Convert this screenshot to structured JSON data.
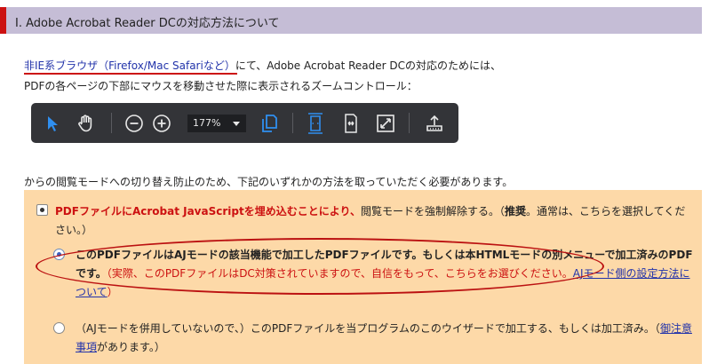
{
  "header": {
    "title": "I. Adobe Acrobat Reader DCの対応方法について"
  },
  "intro": {
    "link_text": "非IE系ブラウザ（Firefox/Mac Safariなど）",
    "line1_rest": "にて、Adobe Acrobat Reader DCの対応のためには、",
    "line2": "PDFの各ページの下部にマウスを移動させた際に表示されるズームコントロール："
  },
  "toolbar": {
    "zoom_value": "177%",
    "icons": [
      "select-arrow-icon",
      "hand-tool-icon",
      "zoom-out-icon",
      "zoom-in-icon",
      "zoom-dropdown",
      "copy-pages-icon",
      "fit-page-icon",
      "fit-width-icon",
      "fullscreen-icon",
      "download-icon"
    ],
    "accent_color": "#2f8ff0"
  },
  "line3": "からの閲覧モードへの切り替え防止のため、下記のいずれかの方法を取っていただく必要があります。",
  "options": {
    "opt1": {
      "red_part": "PDFファイルにAcrobat JavaScriptを埋め込むことにより、",
      "normal_part": "閲覧モードを強制解除する。（",
      "bold_part": "推奨",
      "tail": "。通常は、こちらを選択してください。）"
    },
    "opt2": {
      "bold_part": "このPDFファイルはAJモードの該当機能で加工したPDFファイルです。もしくは本HTMLモードの別メニューで加工済みのPDFです。",
      "red_part": "（実際、このPDFファイルはDC対策されていますので、自信をもって、こちらをお選びください。",
      "link": "AJモード側の設定方法について",
      "close": "）"
    },
    "opt3": {
      "text": "（AJモードを併用していないので、）このPDFファイルを当プログラムのこのウイザードで加工する、もしくは加工済み。（",
      "link": "御注意事項",
      "tail": "があります。）"
    }
  },
  "colors": {
    "panel_bg": "#fdd9a8",
    "header_bg": "#c5bdd6",
    "red": "#cc1111"
  }
}
